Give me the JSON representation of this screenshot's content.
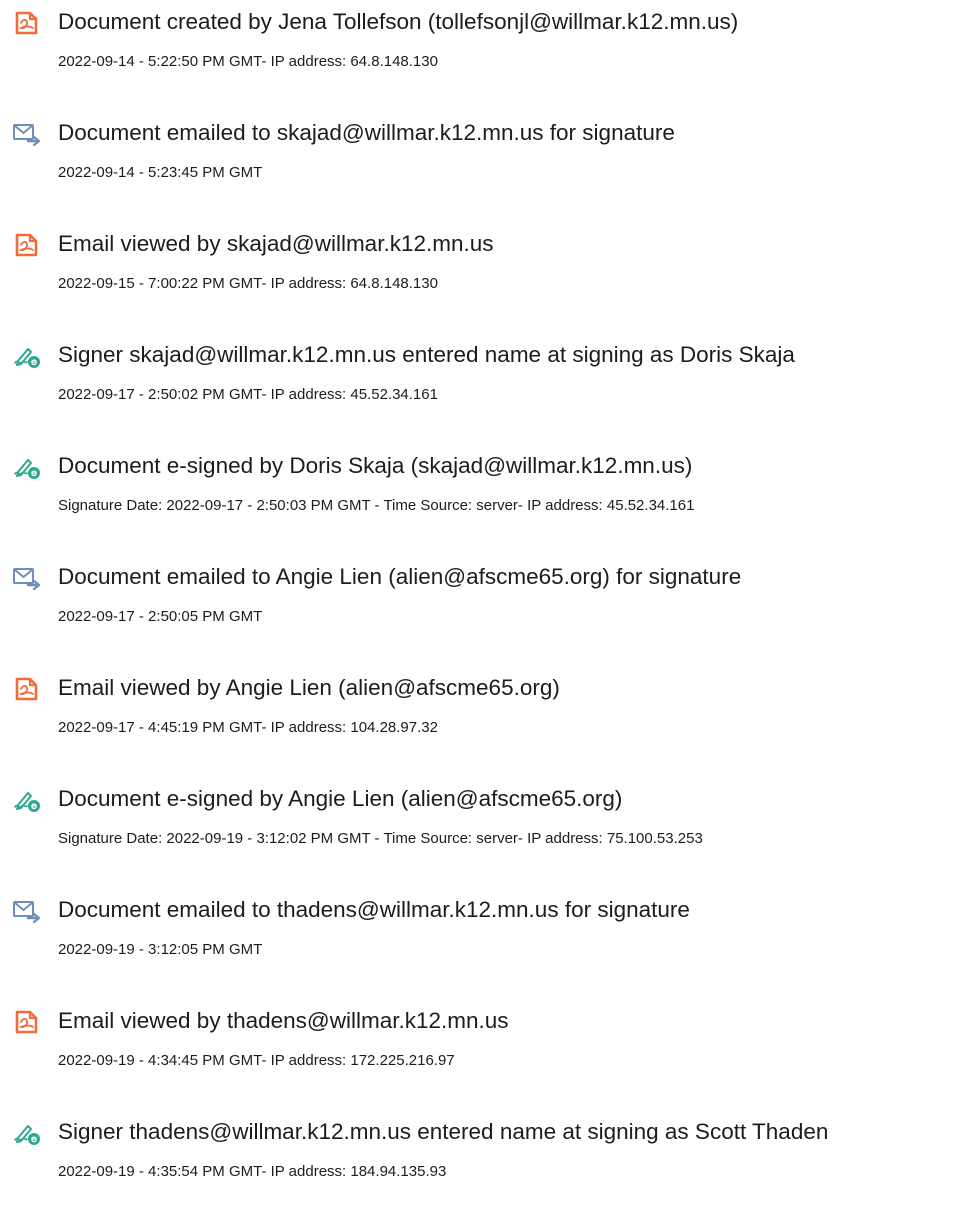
{
  "colors": {
    "doc_icon": "#F26B3A",
    "mail_icon": "#6F8FB8",
    "sign_icon": "#2EA88F",
    "text": "#1C1C1C"
  },
  "events": [
    {
      "icon": "document-icon",
      "title": "Document created by Jena Tollefson (tollefsonjl@willmar.k12.mn.us)",
      "detail": "2022-09-14 - 5:22:50 PM GMT- IP address: 64.8.148.130"
    },
    {
      "icon": "email-icon",
      "title": "Document emailed to skajad@willmar.k12.mn.us for signature",
      "detail": "2022-09-14 - 5:23:45 PM GMT"
    },
    {
      "icon": "document-icon",
      "title": "Email viewed by skajad@willmar.k12.mn.us",
      "detail": "2022-09-15 - 7:00:22 PM GMT- IP address: 64.8.148.130"
    },
    {
      "icon": "e-sign-icon",
      "title": "Signer skajad@willmar.k12.mn.us entered name at signing as Doris Skaja",
      "detail": "2022-09-17 - 2:50:02 PM GMT- IP address: 45.52.34.161"
    },
    {
      "icon": "e-sign-icon",
      "title": "Document e-signed by Doris Skaja (skajad@willmar.k12.mn.us)",
      "detail": "Signature Date: 2022-09-17 - 2:50:03 PM GMT - Time Source: server- IP address: 45.52.34.161"
    },
    {
      "icon": "email-icon",
      "title": "Document emailed to Angie Lien (alien@afscme65.org) for signature",
      "detail": "2022-09-17 - 2:50:05 PM GMT"
    },
    {
      "icon": "document-icon",
      "title": "Email viewed by Angie Lien (alien@afscme65.org)",
      "detail": "2022-09-17 - 4:45:19 PM GMT- IP address: 104.28.97.32"
    },
    {
      "icon": "e-sign-icon",
      "title": "Document e-signed by Angie Lien (alien@afscme65.org)",
      "detail": "Signature Date: 2022-09-19 - 3:12:02 PM GMT - Time Source: server- IP address: 75.100.53.253"
    },
    {
      "icon": "email-icon",
      "title": "Document emailed to thadens@willmar.k12.mn.us for signature",
      "detail": "2022-09-19 - 3:12:05 PM GMT"
    },
    {
      "icon": "document-icon",
      "title": "Email viewed by thadens@willmar.k12.mn.us",
      "detail": "2022-09-19 - 4:34:45 PM GMT- IP address: 172.225.216.97"
    },
    {
      "icon": "e-sign-icon",
      "title": "Signer thadens@willmar.k12.mn.us entered name at signing as Scott Thaden",
      "detail": "2022-09-19 - 4:35:54 PM GMT- IP address: 184.94.135.93"
    }
  ]
}
